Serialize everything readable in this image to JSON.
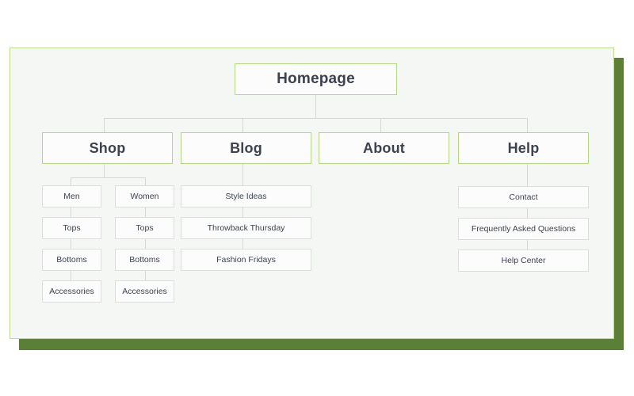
{
  "diagram": {
    "title_node": {
      "label": "Homepage"
    },
    "colors": {
      "canvas_bg": "#f5f7f5",
      "canvas_border": "#bcd98c",
      "shadow": "#5c7f38",
      "primary_border": "#b5d683",
      "leaf_border": "#dcdedc",
      "text": "#3d4250",
      "connector": "#d5d7d5"
    },
    "sections": [
      {
        "label": "Shop",
        "columns": [
          {
            "label": "Men",
            "children": [
              "Tops",
              "Bottoms",
              "Accessories"
            ]
          },
          {
            "label": "Women",
            "children": [
              "Tops",
              "Bottoms",
              "Accessories"
            ]
          }
        ]
      },
      {
        "label": "Blog",
        "children": [
          "Style Ideas",
          "Throwback Thursday",
          "Fashion Fridays"
        ]
      },
      {
        "label": "About",
        "children": []
      },
      {
        "label": "Help",
        "children": [
          "Contact",
          "Frequently Asked Questions",
          "Help Center"
        ]
      }
    ]
  }
}
